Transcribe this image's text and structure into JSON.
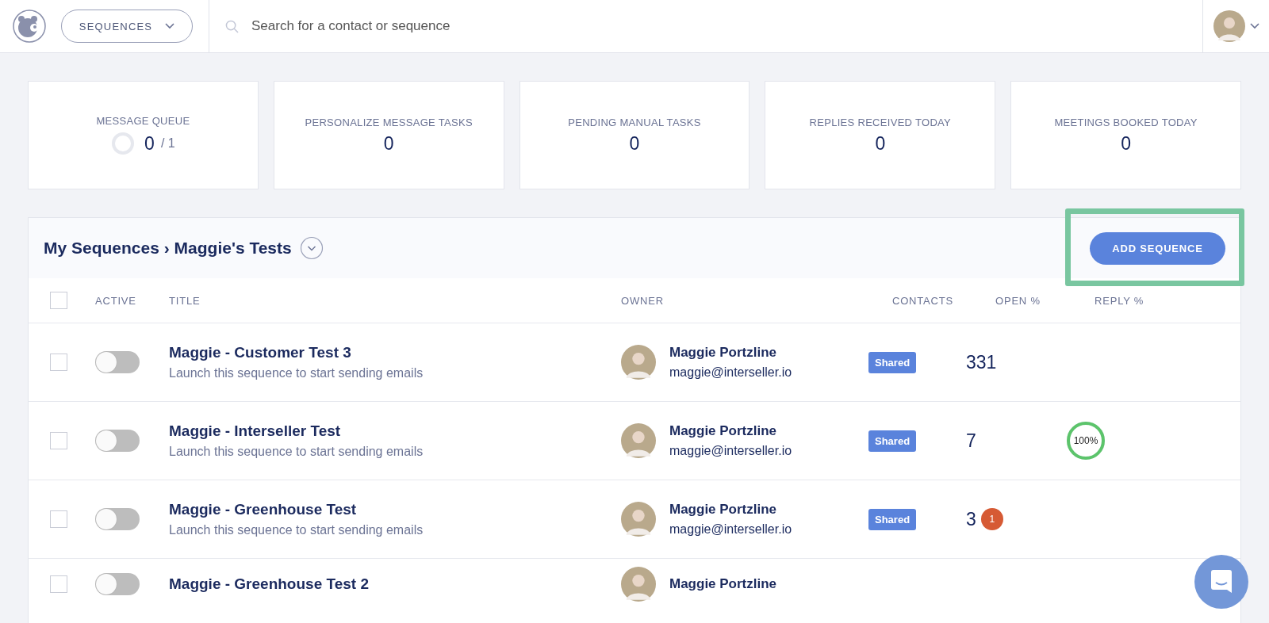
{
  "header": {
    "nav_dropdown": "SEQUENCES",
    "search": {
      "placeholder": "Search for a contact or sequence"
    }
  },
  "stats": [
    {
      "kind": "queue",
      "label": "MESSAGE QUEUE",
      "value": "0",
      "total": "/ 1",
      "level": 0
    },
    {
      "kind": "count",
      "label": "PERSONALIZE MESSAGE TASKS",
      "value": "0"
    },
    {
      "kind": "count",
      "label": "PENDING MANUAL TASKS",
      "value": "0"
    },
    {
      "kind": "count",
      "label": "REPLIES RECEIVED TODAY",
      "value": "0"
    },
    {
      "kind": "count",
      "label": "MEETINGS BOOKED TODAY",
      "value": "0"
    }
  ],
  "panel": {
    "breadcrumb": "My Sequences › Maggie's Tests",
    "add_button": {
      "label": "ADD SEQUENCE",
      "highlighted": true
    }
  },
  "table": {
    "select_all": {
      "checked": false
    },
    "columns": [
      "ACTIVE",
      "TITLE",
      "OWNER",
      "CONTACTS",
      "OPEN %",
      "REPLY %"
    ],
    "rows": [
      {
        "checked": false,
        "active": false,
        "title": "Maggie - Customer Test 3",
        "subtitle": "Launch this sequence to start sending emails",
        "owner": "Maggie Portzline",
        "email": "maggie@interseller.io",
        "tag": "Shared",
        "contacts": "331"
      },
      {
        "checked": false,
        "active": false,
        "title": "Maggie - Interseller Test",
        "subtitle": "Launch this sequence to start sending emails",
        "owner": "Maggie Portzline",
        "email": "maggie@interseller.io",
        "tag": "Shared",
        "contacts": "7",
        "open": {
          "label": "100%",
          "level": 1
        }
      },
      {
        "checked": false,
        "active": false,
        "title": "Maggie - Greenhouse Test",
        "subtitle": "Launch this sequence to start sending emails",
        "owner": "Maggie Portzline",
        "email": "maggie@interseller.io",
        "tag": "Shared",
        "contacts": "3",
        "badge": "1"
      },
      {
        "checked": false,
        "active": false,
        "title": "Maggie - Greenhouse Test 2",
        "owner": "Maggie Portzline"
      }
    ]
  }
}
